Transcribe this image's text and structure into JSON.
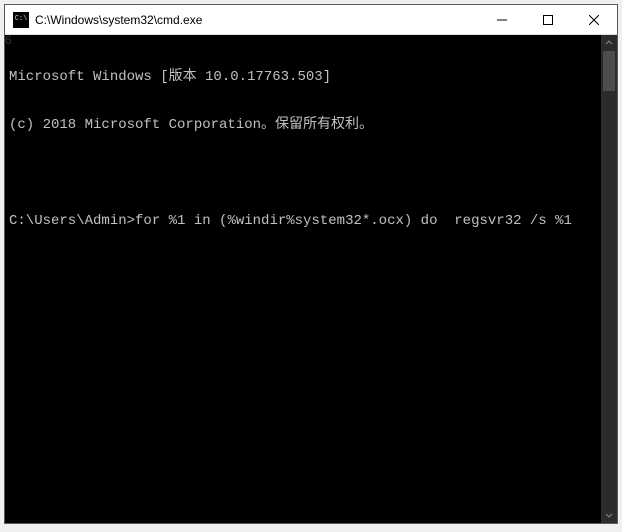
{
  "window": {
    "title": "C:\\Windows\\system32\\cmd.exe",
    "icon_label": "C:\\"
  },
  "corner_label": "6",
  "console": {
    "line1": "Microsoft Windows [版本 10.0.17763.503]",
    "line2": "(c) 2018 Microsoft Corporation。保留所有权利。",
    "prompt": "C:\\Users\\Admin>",
    "command": "for %1 in (%windir%system32*.ocx) do  regsvr32 /s %1"
  }
}
